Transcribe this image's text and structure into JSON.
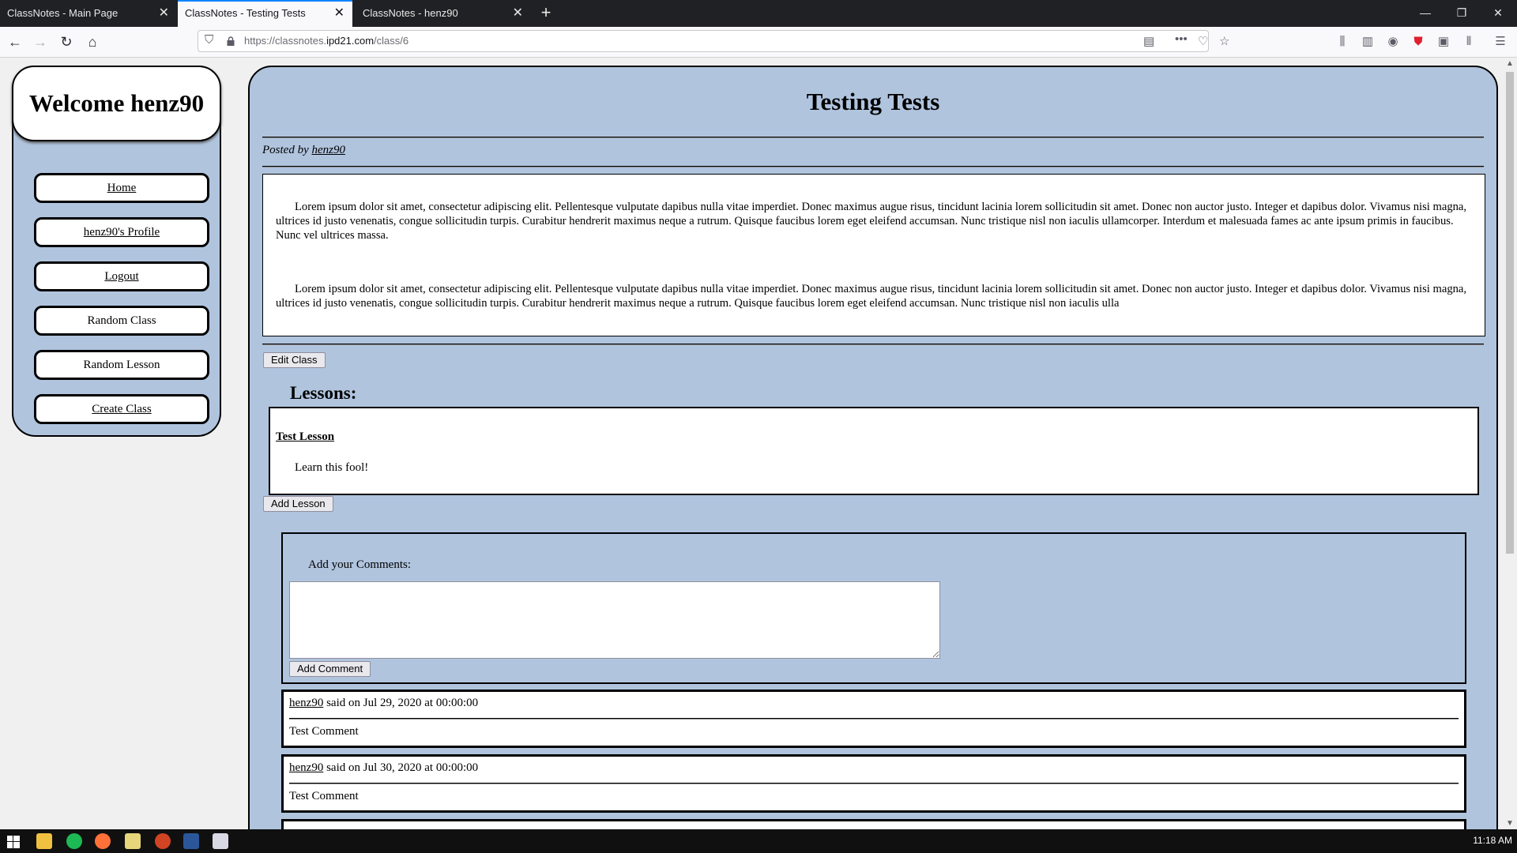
{
  "browser": {
    "tabs": [
      {
        "label": "ClassNotes - Main Page",
        "active": false
      },
      {
        "label": "ClassNotes - Testing Tests",
        "active": true
      },
      {
        "label": "ClassNotes - henz90",
        "active": false
      }
    ],
    "new_tab_glyph": "+",
    "close_glyph": "✕",
    "url_prefix": "https://classnotes.",
    "url_domain": "ipd21.com",
    "url_path": "/class/6",
    "window_controls": {
      "minimize": "—",
      "restore": "❐",
      "close": "✕"
    }
  },
  "sidebar": {
    "welcome": "Welcome henz90",
    "items": [
      {
        "label": "Home"
      },
      {
        "label": "henz90's Profile"
      },
      {
        "label": "Logout"
      },
      {
        "label": "Random Class"
      },
      {
        "label": "Random Lesson"
      },
      {
        "label": "Create Class"
      }
    ]
  },
  "class": {
    "title": "Testing Tests",
    "posted_prefix": "Posted by ",
    "author": "henz90",
    "paragraphs": [
      "Lorem ipsum dolor sit amet, consectetur adipiscing elit. Pellentesque vulputate dapibus nulla vitae imperdiet. Donec maximus augue risus, tincidunt lacinia lorem sollicitudin sit amet. Donec non auctor justo. Integer et dapibus dolor. Vivamus nisi magna, ultrices id justo venenatis, congue sollicitudin turpis. Curabitur hendrerit maximus neque a rutrum. Quisque faucibus lorem eget eleifend accumsan. Nunc tristique nisl non iaculis ullamcorper. Interdum et malesuada fames ac ante ipsum primis in faucibus. Nunc vel ultrices massa.",
      "Lorem ipsum dolor sit amet, consectetur adipiscing elit. Pellentesque vulputate dapibus nulla vitae imperdiet. Donec maximus augue risus, tincidunt lacinia lorem sollicitudin sit amet. Donec non auctor justo. Integer et dapibus dolor. Vivamus nisi magna, ultrices id justo venenatis, congue sollicitudin turpis. Curabitur hendrerit maximus neque a rutrum. Quisque faucibus lorem eget eleifend accumsan. Nunc tristique nisl non iaculis ulla"
    ],
    "edit_button": "Edit Class"
  },
  "lessons": {
    "heading": "Lessons:",
    "items": [
      {
        "title": "Test Lesson",
        "description": "Learn this fool!"
      }
    ],
    "add_button": "Add Lesson"
  },
  "comment_form": {
    "label": "Add your Comments:",
    "textarea_value": "",
    "submit": "Add Comment"
  },
  "comments": [
    {
      "author": "henz90",
      "said": " said on Jul 29, 2020 at 00:00:00",
      "text": "Test Comment"
    },
    {
      "author": "henz90",
      "said": " said on Jul 30, 2020 at 00:00:00",
      "text": "Test Comment"
    }
  ],
  "taskbar": {
    "clock": "11:18 AM"
  },
  "colors": {
    "page_panel": "#b0c4de",
    "tab_active_accent": "#0a84ff"
  }
}
